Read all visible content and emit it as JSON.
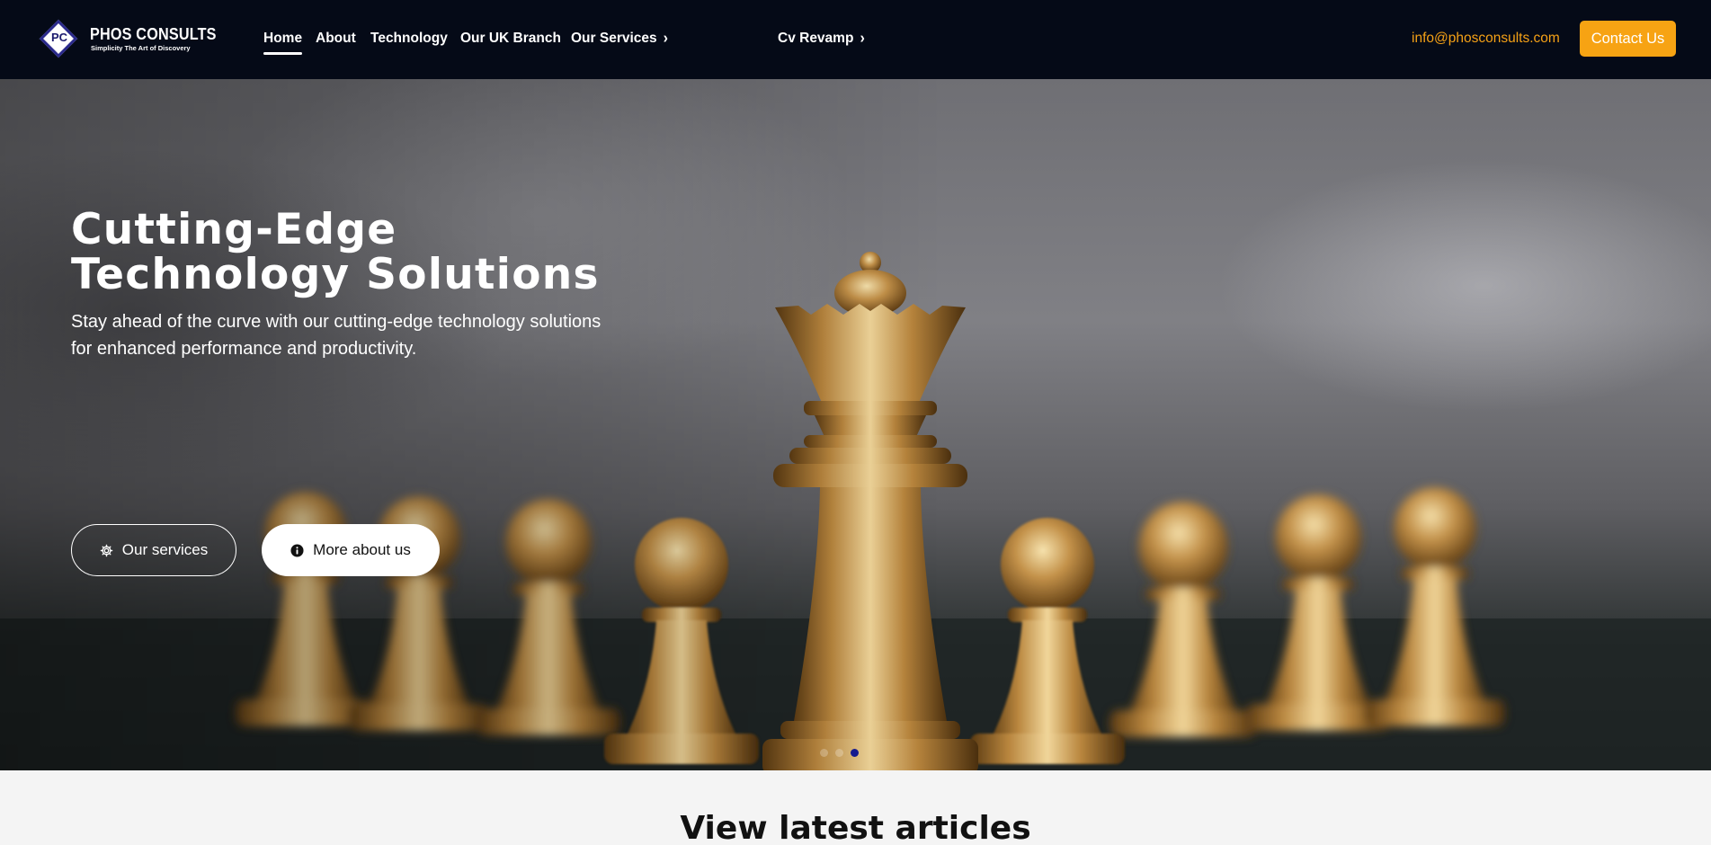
{
  "brand": {
    "logo_initials": "PC",
    "name": "PHOS CONSULTS",
    "tagline": "Simplicity The Art of Discovery"
  },
  "nav": {
    "items": [
      {
        "label": "Home",
        "active": true
      },
      {
        "label": "About"
      },
      {
        "label": "Technology"
      },
      {
        "label": "Our UK Branch"
      },
      {
        "label": "Our Services",
        "icon": "chevron-right-icon"
      },
      {
        "label": "Cv Revamp",
        "icon": "chevron-right-icon"
      }
    ],
    "email": "info@phosconsults.com",
    "contact_label": "Contact Us"
  },
  "hero": {
    "title_line1": "Cutting-Edge",
    "title_line2": "Technology Solutions",
    "subtitle": "Stay ahead of the curve with our cutting-edge technology solutions for enhanced performance and productivity.",
    "primary_button": {
      "label": "Our services",
      "icon": "gear-icon"
    },
    "secondary_button": {
      "label": "More about us",
      "icon": "info-icon"
    },
    "slide_count": 3,
    "active_slide": 3
  },
  "articles": {
    "title": "View latest articles"
  },
  "colors": {
    "navbar_bg": "#050a17",
    "accent": "#f7a313",
    "active_dot": "#141a8e"
  }
}
